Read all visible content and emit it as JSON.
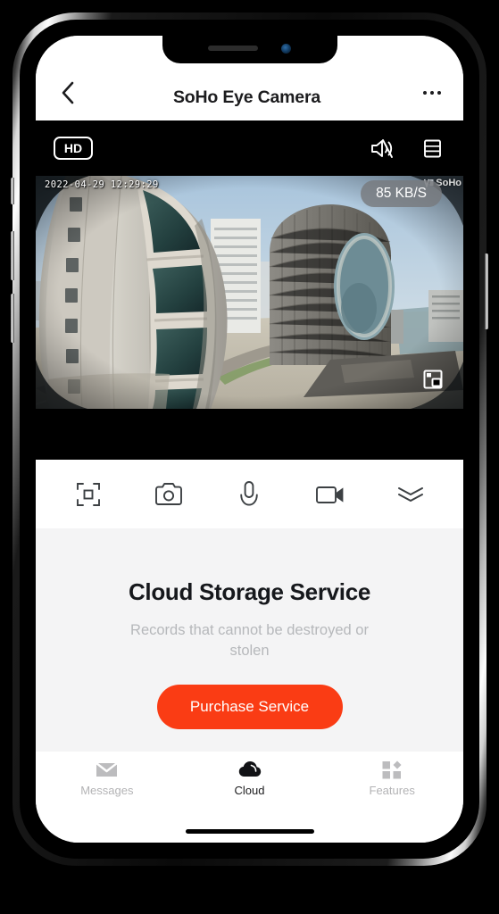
{
  "nav": {
    "back_icon": "chevron-left-icon",
    "title": "SoHo Eye Camera",
    "more_icon": "more-options-icon"
  },
  "video": {
    "quality_badge": "HD",
    "mute_icon": "speaker-muted-icon",
    "layout_icon": "split-view-icon",
    "timestamp": "2022-04-29 12:29:29",
    "bitrate": "85 KB/S",
    "watermark": "SoHo",
    "pip_icon": "picture-in-picture-icon",
    "scene_description": "Aerial fisheye city view with office towers, highway and waterfront"
  },
  "controls": [
    {
      "name": "fullscreen-button",
      "icon": "fullscreen-frame-icon"
    },
    {
      "name": "snapshot-button",
      "icon": "camera-icon"
    },
    {
      "name": "talk-button",
      "icon": "microphone-icon"
    },
    {
      "name": "record-button",
      "icon": "video-camera-icon"
    },
    {
      "name": "expand-button",
      "icon": "double-chevron-down-icon"
    }
  ],
  "cloud": {
    "title": "Cloud Storage Service",
    "subtitle": "Records that cannot be destroyed or stolen",
    "purchase_label": "Purchase Service",
    "accent_color": "#fa3c14"
  },
  "tabs": [
    {
      "label": "Messages",
      "icon": "envelope-icon",
      "active": false
    },
    {
      "label": "Cloud",
      "icon": "cloud-icon",
      "active": true
    },
    {
      "label": "Features",
      "icon": "grid-squares-icon",
      "active": false
    }
  ]
}
